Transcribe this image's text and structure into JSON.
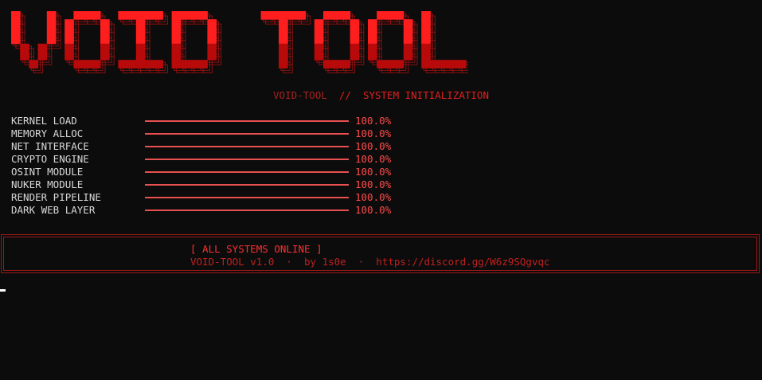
{
  "logo": {
    "text": "VOID TOOL",
    "colors": {
      "top": "#ff1e1e",
      "bottom": "#b80a0a",
      "outline": "#8a1010"
    }
  },
  "subtitle": {
    "app": "VOID-TOOL",
    "separator": "//",
    "message": "SYSTEM INITIALIZATION"
  },
  "modules": [
    {
      "label": "KERNEL LOAD",
      "progress": 1.0,
      "percent_text": "100.0%"
    },
    {
      "label": "MEMORY ALLOC",
      "progress": 1.0,
      "percent_text": "100.0%"
    },
    {
      "label": "NET INTERFACE",
      "progress": 1.0,
      "percent_text": "100.0%"
    },
    {
      "label": "CRYPTO ENGINE",
      "progress": 1.0,
      "percent_text": "100.0%"
    },
    {
      "label": "OSINT MODULE",
      "progress": 1.0,
      "percent_text": "100.0%"
    },
    {
      "label": "NUKER MODULE",
      "progress": 1.0,
      "percent_text": "100.0%"
    },
    {
      "label": "RENDER PIPELINE",
      "progress": 1.0,
      "percent_text": "100.0%"
    },
    {
      "label": "DARK WEB LAYER",
      "progress": 1.0,
      "percent_text": "100.0%"
    }
  ],
  "status": {
    "headline": "[ ALL SYSTEMS ONLINE ]",
    "info": "VOID-TOOL v1.0  ·  by 1s0e  ·  https://discord.gg/W6z9SQgvqc"
  },
  "colors": {
    "background": "#0c0c0c",
    "accent": "#ff3030",
    "bar": "#e85050",
    "label": "#d8d8d8"
  }
}
